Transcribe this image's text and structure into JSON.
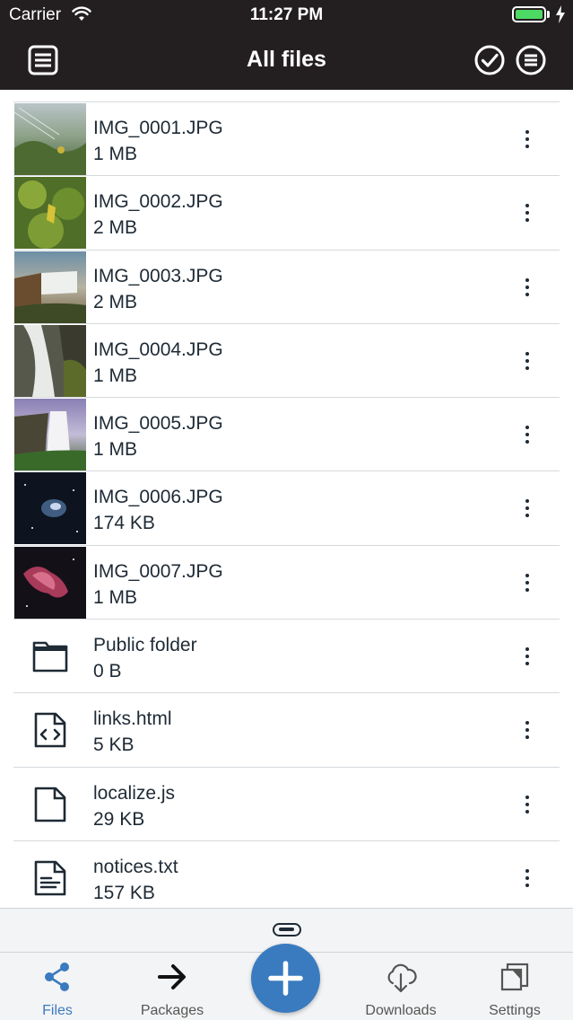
{
  "status_bar": {
    "carrier": "Carrier",
    "time": "11:27 PM"
  },
  "nav": {
    "title": "All files"
  },
  "files": [
    {
      "name": "IMG_0001.JPG",
      "size": "1 MB",
      "kind": "image"
    },
    {
      "name": "IMG_0002.JPG",
      "size": "2 MB",
      "kind": "image"
    },
    {
      "name": "IMG_0003.JPG",
      "size": "2 MB",
      "kind": "image"
    },
    {
      "name": "IMG_0004.JPG",
      "size": "1 MB",
      "kind": "image"
    },
    {
      "name": "IMG_0005.JPG",
      "size": "1 MB",
      "kind": "image"
    },
    {
      "name": "IMG_0006.JPG",
      "size": "174 KB",
      "kind": "image"
    },
    {
      "name": "IMG_0007.JPG",
      "size": "1 MB",
      "kind": "image"
    },
    {
      "name": "Public folder",
      "size": "0 B",
      "kind": "folder"
    },
    {
      "name": "links.html",
      "size": "5 KB",
      "kind": "code-file"
    },
    {
      "name": "localize.js",
      "size": "29 KB",
      "kind": "file"
    },
    {
      "name": "notices.txt",
      "size": "157 KB",
      "kind": "text-file"
    }
  ],
  "tabs": {
    "files": "Files",
    "packages": "Packages",
    "downloads": "Downloads",
    "settings": "Settings"
  },
  "colors": {
    "accent": "#3a7bbf",
    "nav_background": "#231f20",
    "battery": "#4cd964"
  }
}
